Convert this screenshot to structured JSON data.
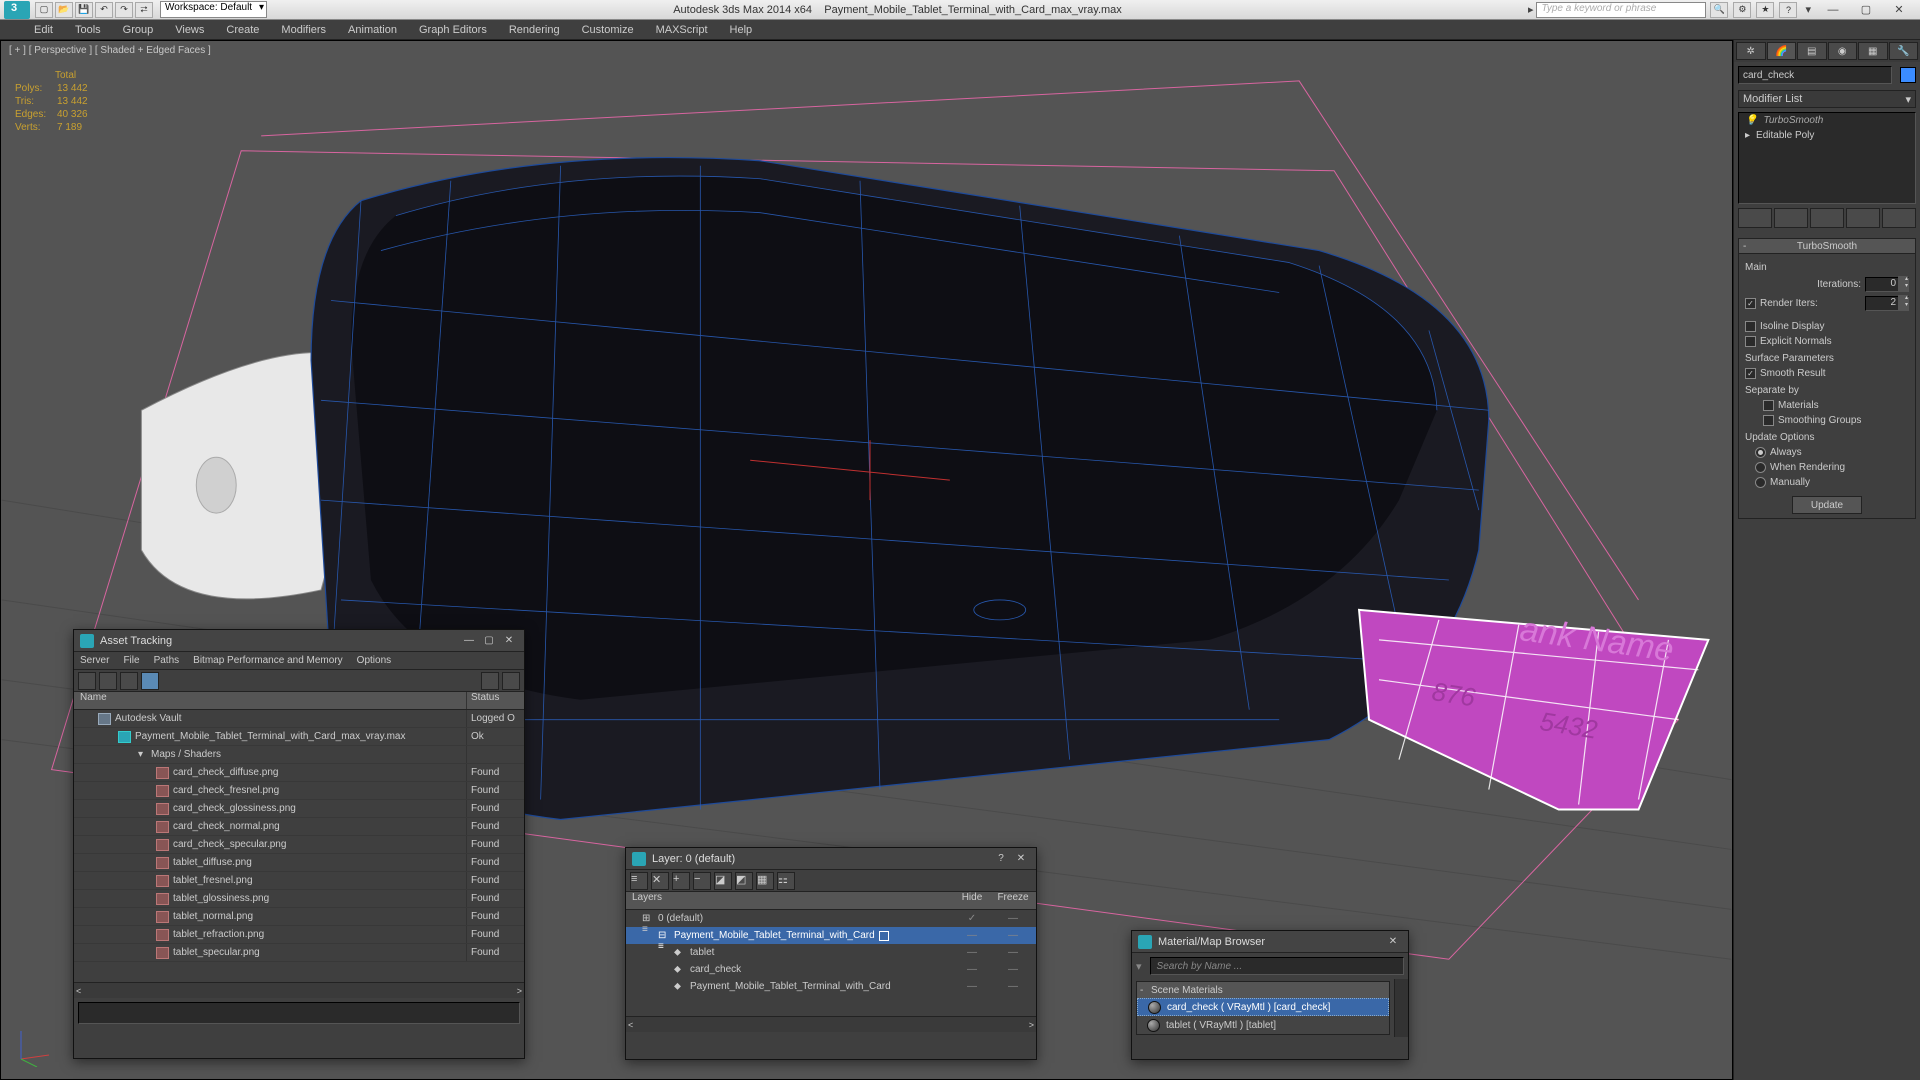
{
  "title": {
    "app": "Autodesk 3ds Max  2014 x64",
    "file": "Payment_Mobile_Tablet_Terminal_with_Card_max_vray.max"
  },
  "workspace_label": "Workspace: Default",
  "search_placeholder": "Type a keyword or phrase",
  "menus": [
    "Edit",
    "Tools",
    "Group",
    "Views",
    "Create",
    "Modifiers",
    "Animation",
    "Graph Editors",
    "Rendering",
    "Customize",
    "MAXScript",
    "Help"
  ],
  "viewport_label": "[ + ] [ Perspective ] [ Shaded + Edged Faces ]",
  "stats": {
    "title": "Total",
    "rows": [
      [
        "Polys:",
        "13 442"
      ],
      [
        "Tris:",
        "13 442"
      ],
      [
        "Edges:",
        "40 326"
      ],
      [
        "Verts:",
        "7 189"
      ]
    ]
  },
  "obj_name": "card_check",
  "modifier_list_label": "Modifier List",
  "mod_stack": [
    {
      "name": "TurboSmooth",
      "italic": true
    },
    {
      "name": "Editable Poly",
      "italic": false
    }
  ],
  "rollout_title": "TurboSmooth",
  "rollout": {
    "main": "Main",
    "iterations": "Iterations:",
    "iter_val": "0",
    "render_iters": "Render Iters:",
    "ri_val": "2",
    "isoline": "Isoline Display",
    "explicit": "Explicit Normals",
    "surf": "Surface Parameters",
    "smooth": "Smooth Result",
    "separate": "Separate by",
    "materials": "Materials",
    "smgroups": "Smoothing Groups",
    "updopt": "Update Options",
    "always": "Always",
    "whenr": "When Rendering",
    "manual": "Manually",
    "update": "Update"
  },
  "asset": {
    "title": "Asset Tracking",
    "menus": [
      "Server",
      "File",
      "Paths",
      "Bitmap Performance and Memory",
      "Options"
    ],
    "col_name": "Name",
    "col_status": "Status",
    "rows": [
      {
        "icon": "vault",
        "ind": 0,
        "name": "Autodesk Vault",
        "status": "Logged O"
      },
      {
        "icon": "max",
        "ind": 1,
        "name": "Payment_Mobile_Tablet_Terminal_with_Card_max_vray.max",
        "status": "Ok"
      },
      {
        "icon": "",
        "ind": 2,
        "name": "Maps / Shaders",
        "status": ""
      },
      {
        "icon": "img",
        "ind": 3,
        "name": "card_check_diffuse.png",
        "status": "Found"
      },
      {
        "icon": "img",
        "ind": 3,
        "name": "card_check_fresnel.png",
        "status": "Found"
      },
      {
        "icon": "img",
        "ind": 3,
        "name": "card_check_glossiness.png",
        "status": "Found"
      },
      {
        "icon": "img",
        "ind": 3,
        "name": "card_check_normal.png",
        "status": "Found"
      },
      {
        "icon": "img",
        "ind": 3,
        "name": "card_check_specular.png",
        "status": "Found"
      },
      {
        "icon": "img",
        "ind": 3,
        "name": "tablet_diffuse.png",
        "status": "Found"
      },
      {
        "icon": "img",
        "ind": 3,
        "name": "tablet_fresnel.png",
        "status": "Found"
      },
      {
        "icon": "img",
        "ind": 3,
        "name": "tablet_glossiness.png",
        "status": "Found"
      },
      {
        "icon": "img",
        "ind": 3,
        "name": "tablet_normal.png",
        "status": "Found"
      },
      {
        "icon": "img",
        "ind": 3,
        "name": "tablet_refraction.png",
        "status": "Found"
      },
      {
        "icon": "img",
        "ind": 3,
        "name": "tablet_specular.png",
        "status": "Found"
      }
    ]
  },
  "layer": {
    "title": "Layer: 0 (default)",
    "col_layers": "Layers",
    "col_hide": "Hide",
    "col_freeze": "Freeze",
    "rows": [
      {
        "ind": 0,
        "name": "0 (default)",
        "chk": true,
        "sel": false
      },
      {
        "ind": 1,
        "name": "Payment_Mobile_Tablet_Terminal_with_Card",
        "chk": false,
        "sel": true,
        "box": true
      },
      {
        "ind": 2,
        "name": "tablet",
        "sel": false
      },
      {
        "ind": 2,
        "name": "card_check",
        "sel": false
      },
      {
        "ind": 2,
        "name": "Payment_Mobile_Tablet_Terminal_with_Card",
        "sel": false
      }
    ]
  },
  "mat": {
    "title": "Material/Map Browser",
    "search": "Search by Name ...",
    "section": "Scene Materials",
    "items": [
      {
        "name": "card_check ( VRayMtl ) [card_check]",
        "sel": true
      },
      {
        "name": "tablet ( VRayMtl ) [tablet]",
        "sel": false
      }
    ]
  }
}
